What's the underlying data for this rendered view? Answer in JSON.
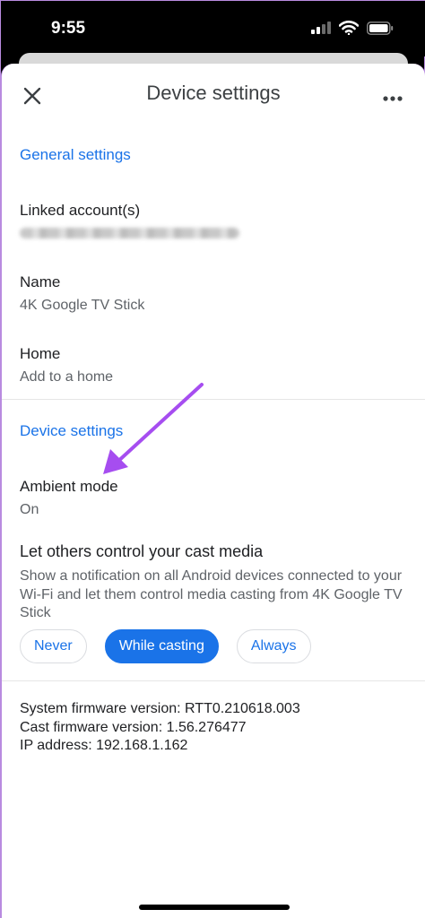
{
  "status_bar": {
    "time": "9:55"
  },
  "header": {
    "title": "Device settings"
  },
  "general_section": {
    "title": "General settings"
  },
  "linked_account": {
    "title": "Linked account(s)"
  },
  "name": {
    "title": "Name",
    "value": "4K Google TV Stick"
  },
  "home": {
    "title": "Home",
    "value": "Add to a home"
  },
  "device_section": {
    "title": "Device settings"
  },
  "ambient_mode": {
    "title": "Ambient mode",
    "value": "On"
  },
  "cast_control": {
    "title": "Let others control your cast media",
    "description": "Show a notification on all Android devices connected to your Wi-Fi and let them control media casting from 4K Google TV Stick",
    "options": [
      "Never",
      "While casting",
      "Always"
    ],
    "selected": "While casting"
  },
  "firmware": {
    "system": "System firmware version: RTT0.210618.003",
    "cast": "Cast firmware version: 1.56.276477",
    "ip": "IP address: 192.168.1.162"
  },
  "colors": {
    "accent": "#1a73e8",
    "annotation_arrow": "#a64df0"
  }
}
